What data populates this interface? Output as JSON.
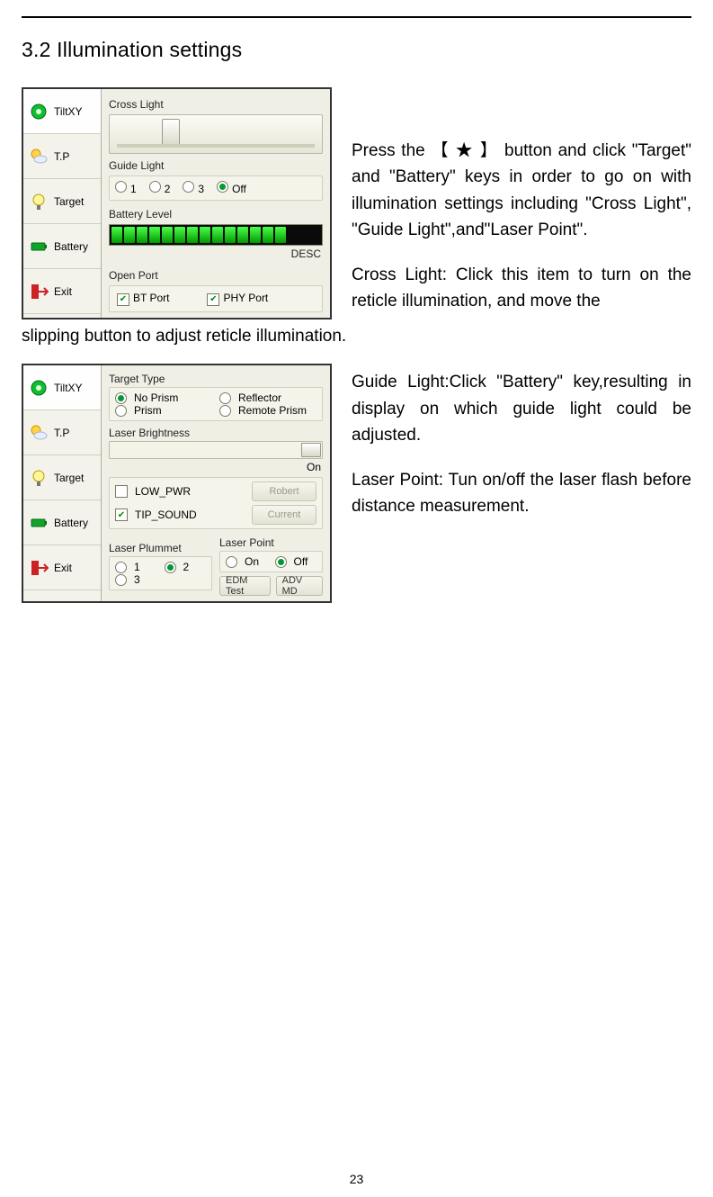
{
  "page_number": "23",
  "section_title": "3.2 Illumination settings",
  "paragraphs": {
    "p1": "Press the 【 ★ 】  button and click \"Target\" and \"Battery\" keys in order to go on with illumination settings including \"Cross Light\", \"Guide Light\",and\"Laser Point\".",
    "p2_lead": "Cross Light: Click this item to turn on the reticle illumination, and move the",
    "p2_tail": "slipping button to adjust reticle illumination.",
    "p3": "Guide Light:Click \"Battery\" key,resulting in display on which guide light could be adjusted.",
    "p4": "Laser Point: Tun on/off the laser flash before distance measurement."
  },
  "screenshot1": {
    "tabs": [
      "TiltXY",
      "T.P",
      "Target",
      "Battery",
      "Exit"
    ],
    "cross_light_label": "Cross Light",
    "guide_light": {
      "label": "Guide Light",
      "options": [
        "1",
        "2",
        "3",
        "Off"
      ],
      "selected": "Off"
    },
    "battery_level_label": "Battery Level",
    "battery_desc": "DESC",
    "open_port": {
      "label": "Open Port",
      "bt": "BT Port",
      "phy": "PHY Port"
    }
  },
  "screenshot2": {
    "tabs": [
      "TiltXY",
      "T.P",
      "Target",
      "Battery",
      "Exit"
    ],
    "target_type": {
      "label": "Target Type",
      "options": [
        "No Prism",
        "Reflector",
        "Prism",
        "Remote Prism"
      ],
      "selected": "No Prism"
    },
    "laser_brightness_label": "Laser Brightness",
    "laser_on_label": "On",
    "low_pwr": "LOW_PWR",
    "tip_sound": "TIP_SOUND",
    "btn_robert": "Robert",
    "btn_current": "Current",
    "laser_plummet": {
      "label": "Laser Plummet",
      "options": [
        "1",
        "2",
        "3"
      ],
      "selected": "2"
    },
    "laser_point": {
      "label": "Laser Point",
      "options": [
        "On",
        "Off"
      ],
      "selected": "Off"
    },
    "edm_test_btn": "EDM Test",
    "adv_md_btn": "ADV MD"
  }
}
